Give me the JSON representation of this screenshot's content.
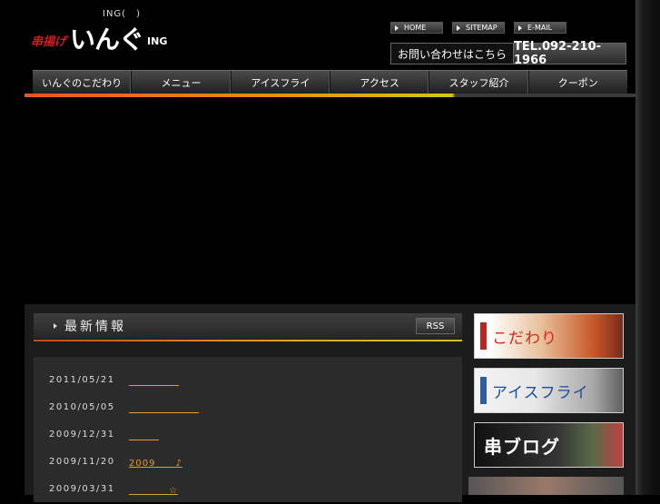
{
  "header": {
    "tagline": "ING(　)",
    "logo_small": "串揚げ",
    "logo_big": "いんぐ",
    "logo_ing": "ING"
  },
  "toplinks": [
    {
      "label": "HOME",
      "icon": "arrow-right-icon"
    },
    {
      "label": "SITEMAP",
      "icon": "arrow-right-icon"
    },
    {
      "label": "E-MAIL",
      "icon": "arrow-right-icon"
    }
  ],
  "contact": {
    "label": "お問い合わせはこちら",
    "tel": "TEL.092-210-1966"
  },
  "nav": [
    {
      "label": "いんぐのこだわり"
    },
    {
      "label": "メニュー"
    },
    {
      "label": "アイスフライ"
    },
    {
      "label": "アクセス"
    },
    {
      "label": "スタッフ紹介"
    },
    {
      "label": "クーポン"
    }
  ],
  "news": {
    "title": "最新情報",
    "rss_label": "RSS",
    "items": [
      {
        "date": "2011/05/21",
        "link": "　　　　　"
      },
      {
        "date": "2010/05/05",
        "link": "　　　　　　　"
      },
      {
        "date": "2009/12/31",
        "link": "　　　"
      },
      {
        "date": "2009/11/20",
        "link": "2009　　♪"
      },
      {
        "date": "2009/03/31",
        "link": "　　　　☆"
      }
    ]
  },
  "sidebar": {
    "banners": [
      {
        "label": "こだわり"
      },
      {
        "label": "アイスフライ"
      },
      {
        "label": "串ブログ"
      }
    ]
  },
  "colors": {
    "accent_orange": "#e0a030",
    "accent_red": "#c0231c",
    "background": "#000000"
  }
}
